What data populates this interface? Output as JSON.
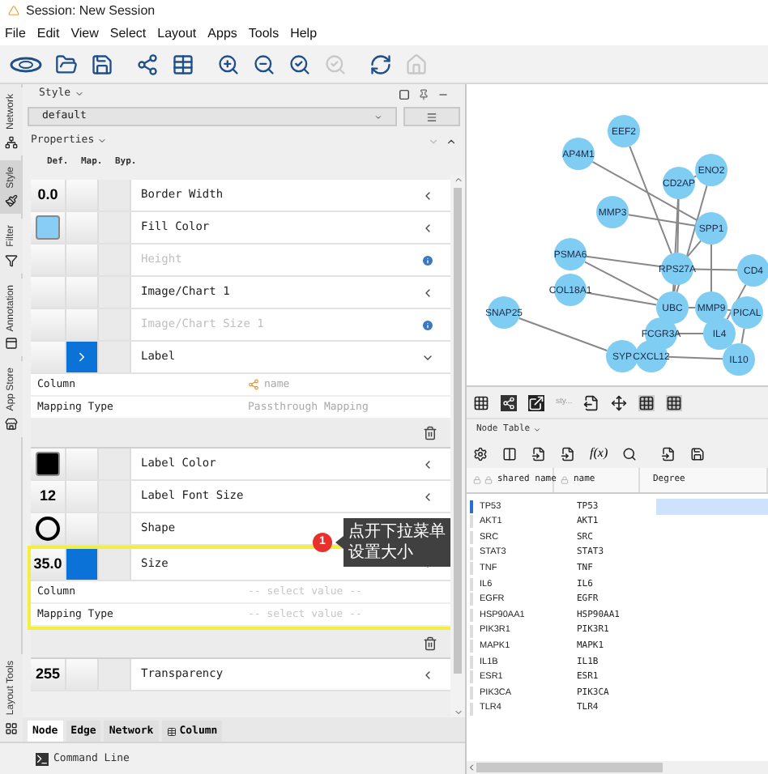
{
  "window": {
    "title": "Session: New Session"
  },
  "menu": [
    "File",
    "Edit",
    "View",
    "Select",
    "Layout",
    "Apps",
    "Tools",
    "Help"
  ],
  "side_tabs": [
    {
      "label": "Network",
      "selected": false
    },
    {
      "label": "Style",
      "selected": true
    },
    {
      "label": "Filter",
      "selected": false
    },
    {
      "label": "Annotation",
      "selected": false
    },
    {
      "label": "App Store",
      "selected": false
    },
    {
      "label": "Layout Tools",
      "selected": false
    }
  ],
  "style_panel": {
    "title": "Style",
    "style_value": "default",
    "properties_title": "Properties",
    "columns": [
      "Def.",
      "Map.",
      "Byp."
    ],
    "properties": [
      {
        "label": "Border Width",
        "kind": "text",
        "value": "0.0",
        "disabled": false,
        "mapped": false,
        "expanded": false
      },
      {
        "label": "Fill Color",
        "kind": "color",
        "color": "#87cdf5",
        "disabled": false,
        "mapped": false,
        "expanded": false
      },
      {
        "label": "Height",
        "kind": "none",
        "disabled": true,
        "mapped": false,
        "expanded": false
      },
      {
        "label": "Image/Chart 1",
        "kind": "none",
        "disabled": false,
        "mapped": false,
        "expanded": false
      },
      {
        "label": "Image/Chart Size 1",
        "kind": "none",
        "disabled": true,
        "mapped": false,
        "expanded": false
      },
      {
        "label": "Label",
        "kind": "none",
        "disabled": false,
        "mapped": true,
        "expanded": true,
        "highlighted": false,
        "mapping": [
          {
            "label": "Column",
            "value": "name",
            "empty": false
          },
          {
            "label": "Mapping Type",
            "value": "Passthrough Mapping",
            "empty": false
          }
        ]
      },
      {
        "label": "Label Color",
        "kind": "color",
        "color": "#000000",
        "disabled": false,
        "mapped": false,
        "expanded": false
      },
      {
        "label": "Label Font Size",
        "kind": "text",
        "value": "12",
        "disabled": false,
        "mapped": false,
        "expanded": false
      },
      {
        "label": "Shape",
        "kind": "shape",
        "disabled": false,
        "mapped": false,
        "expanded": false
      },
      {
        "label": "Size",
        "kind": "text",
        "value": "35.0",
        "disabled": false,
        "mapped": true,
        "expanded": true,
        "highlighted": true,
        "mapping": [
          {
            "label": "Column",
            "value": "-- select value --",
            "empty": true
          },
          {
            "label": "Mapping Type",
            "value": "-- select value --",
            "empty": true
          }
        ]
      },
      {
        "label": "Transparency",
        "kind": "text",
        "value": "255",
        "disabled": false,
        "mapped": false,
        "expanded": false
      }
    ]
  },
  "callout": {
    "badge": "1",
    "text": "点开下拉菜单设置大小"
  },
  "bottom_tabs": [
    {
      "label": "Node",
      "selected": true
    },
    {
      "label": "Edge",
      "selected": false
    },
    {
      "label": "Network",
      "selected": false
    },
    {
      "label": "Column",
      "selected": false
    }
  ],
  "command_line": "Command Line",
  "network": {
    "nodes": [
      "EEF2",
      "AP4M1",
      "ENO2",
      "CD2AP",
      "MMP3",
      "SPP1",
      "PSMA6",
      "RPS27A",
      "CD4",
      "COL18A1",
      "SNAP25",
      "UBC",
      "MMP9",
      "PICAL",
      "FCGR3A",
      "IL4",
      "SYP",
      "CXCL12",
      "IL10"
    ],
    "style_field": "sty..."
  },
  "node_table": {
    "title": "Node Table",
    "function_label": "f(x)",
    "columns": [
      "shared name",
      "name",
      "Degree"
    ],
    "rows": [
      {
        "shared_name": "TP53",
        "name": "TP53",
        "selected": true
      },
      {
        "shared_name": "AKT1",
        "name": "AKT1",
        "selected": false
      },
      {
        "shared_name": "SRC",
        "name": "SRC",
        "selected": false
      },
      {
        "shared_name": "STAT3",
        "name": "STAT3",
        "selected": false
      },
      {
        "shared_name": "TNF",
        "name": "TNF",
        "selected": false
      },
      {
        "shared_name": "IL6",
        "name": "IL6",
        "selected": false
      },
      {
        "shared_name": "EGFR",
        "name": "EGFR",
        "selected": false
      },
      {
        "shared_name": "HSP90AA1",
        "name": "HSP90AA1",
        "selected": false
      },
      {
        "shared_name": "PIK3R1",
        "name": "PIK3R1",
        "selected": false
      },
      {
        "shared_name": "MAPK1",
        "name": "MAPK1",
        "selected": false
      },
      {
        "shared_name": "IL1B",
        "name": "IL1B",
        "selected": false
      },
      {
        "shared_name": "ESR1",
        "name": "ESR1",
        "selected": false
      },
      {
        "shared_name": "PIK3CA",
        "name": "PIK3CA",
        "selected": false
      },
      {
        "shared_name": "TLR4",
        "name": "TLR4",
        "selected": false
      }
    ]
  }
}
